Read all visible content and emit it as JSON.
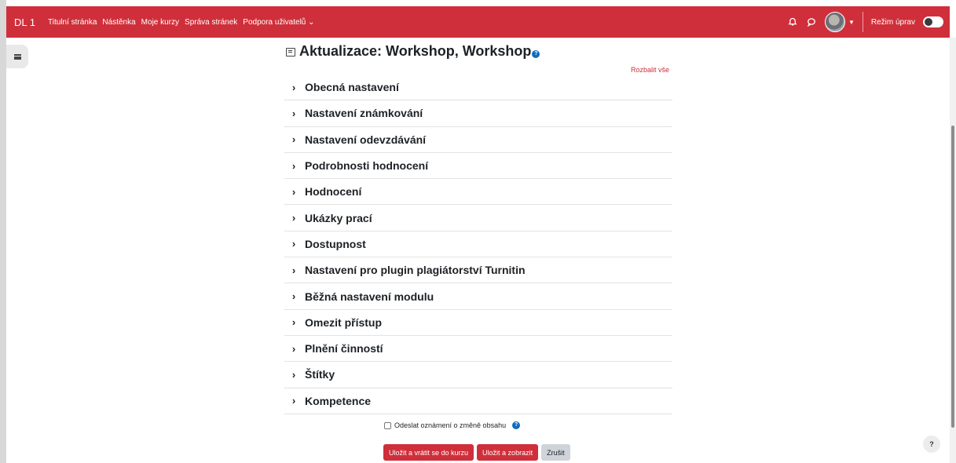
{
  "navbar": {
    "brand": "DL 1",
    "links": [
      "Titulní stránka",
      "Nástěnka",
      "Moje kurzy",
      "Správa stránek",
      "Podpora uživatelů"
    ],
    "edit_mode_label": "Režim úprav"
  },
  "page": {
    "title": "Aktualizace: Workshop, Workshop",
    "expand_all": "Rozbalit vše"
  },
  "sections": [
    "Obecná nastavení",
    "Nastavení známkování",
    "Nastavení odevzdávání",
    "Podrobnosti hodnocení",
    "Hodnocení",
    "Ukázky prací",
    "Dostupnost",
    "Nastavení pro plugin plagiátorství Turnitin",
    "Běžná nastavení modulu",
    "Omezit přístup",
    "Plnění činností",
    "Štítky",
    "Kompetence"
  ],
  "notify_label": "Odeslat oznámení o změně obsahu",
  "buttons": {
    "save_return": "Uložit a vrátit se do kurzu",
    "save_display": "Uložit a zobrazit",
    "cancel": "Zrušit"
  },
  "colors": {
    "brand": "#cf2f3a",
    "help": "#0f6cbf"
  }
}
